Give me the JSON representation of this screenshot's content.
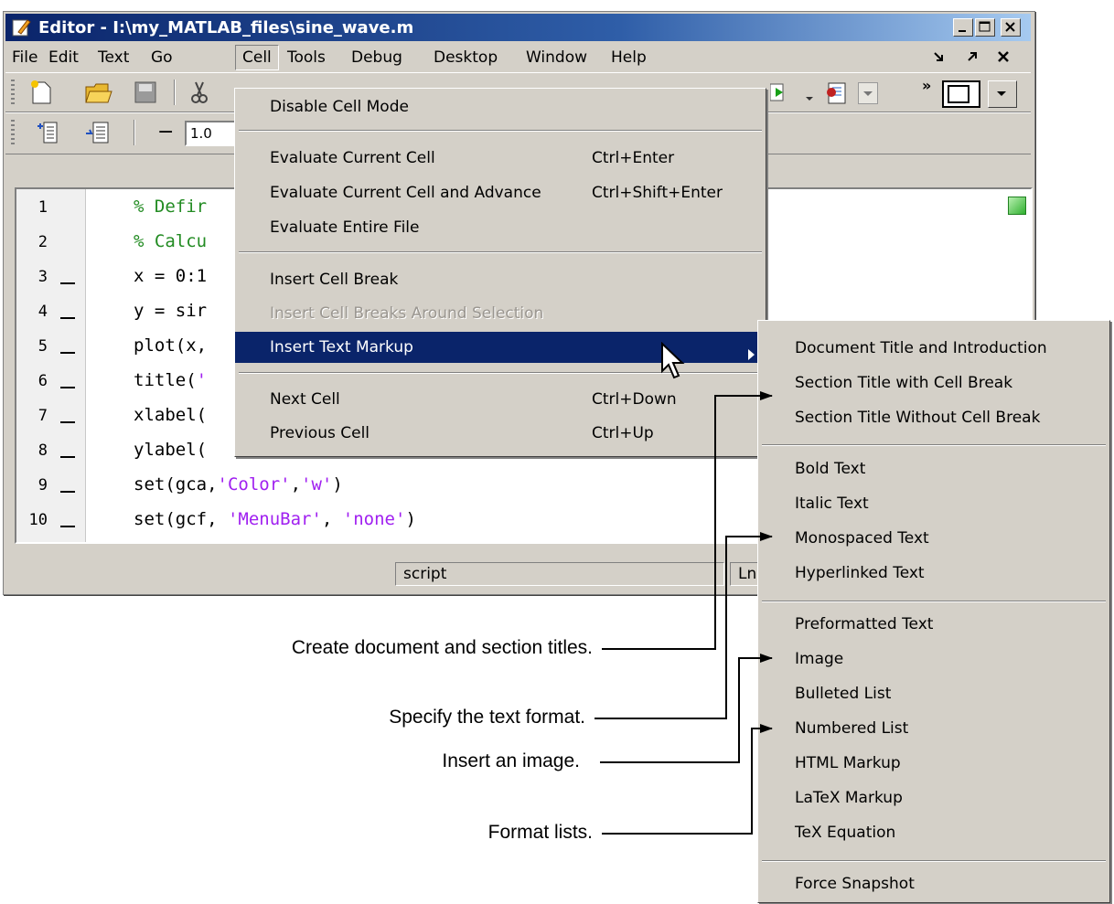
{
  "window": {
    "title": "Editor - I:\\my_MATLAB_files\\sine_wave.m",
    "controls": [
      "minimize",
      "maximize",
      "close"
    ]
  },
  "menubar": {
    "items": [
      "File",
      "Edit",
      "Text",
      "Go",
      "Cell",
      "Tools",
      "Debug",
      "Desktop",
      "Window",
      "Help"
    ],
    "open_item": "Cell"
  },
  "toolbar2": {
    "cell_minus": "−",
    "cell_value": "1.0"
  },
  "editor": {
    "line_numbers": [
      "1",
      "2",
      "3",
      "4",
      "5",
      "6",
      "7",
      "8",
      "9",
      "10"
    ],
    "code": {
      "l1": "% Defir",
      "l2": "% Calcu",
      "l3": "x = 0:1",
      "l4": "y = sir",
      "l5": "plot(x,",
      "l6a": "title(",
      "l6b": "'",
      "l7": "xlabel(",
      "l8": "ylabel(",
      "l9a": "set(gca,",
      "l9b": "'Color'",
      "l9c": ",",
      "l9d": "'w'",
      "l9e": ")",
      "l10a": "set(gcf, ",
      "l10b": "'MenuBar'",
      "l10c": ", ",
      "l10d": "'none'",
      "l10e": ")"
    }
  },
  "statusbar": {
    "mode": "script",
    "position": "Ln"
  },
  "cell_menu": {
    "disable": "Disable Cell Mode",
    "eval_current": "Evaluate Current Cell",
    "eval_current_sc": "Ctrl+Enter",
    "eval_advance": "Evaluate Current Cell and Advance",
    "eval_advance_sc": "Ctrl+Shift+Enter",
    "eval_file": "Evaluate Entire File",
    "insert_break": "Insert Cell Break",
    "insert_breaks_around": "Insert Cell Breaks Around Selection",
    "insert_markup": "Insert Text Markup",
    "next": "Next Cell",
    "next_sc": "Ctrl+Down",
    "prev": "Previous Cell",
    "prev_sc": "Ctrl+Up"
  },
  "submenu": {
    "doc_title": "Document Title and Introduction",
    "section_break": "Section Title with Cell Break",
    "section_nobreak": "Section Title Without Cell Break",
    "bold": "Bold Text",
    "italic": "Italic Text",
    "mono": "Monospaced Text",
    "hyperlink": "Hyperlinked Text",
    "preformatted": "Preformatted Text",
    "image": "Image",
    "bulleted": "Bulleted List",
    "numbered": "Numbered List",
    "html": "HTML Markup",
    "latex": "LaTeX Markup",
    "tex": "TeX Equation",
    "snapshot": "Force Snapshot"
  },
  "callouts": {
    "titles": "Create document and section titles.",
    "format": "Specify the  text format.",
    "image": "Insert an image.",
    "lists": "Format lists."
  }
}
